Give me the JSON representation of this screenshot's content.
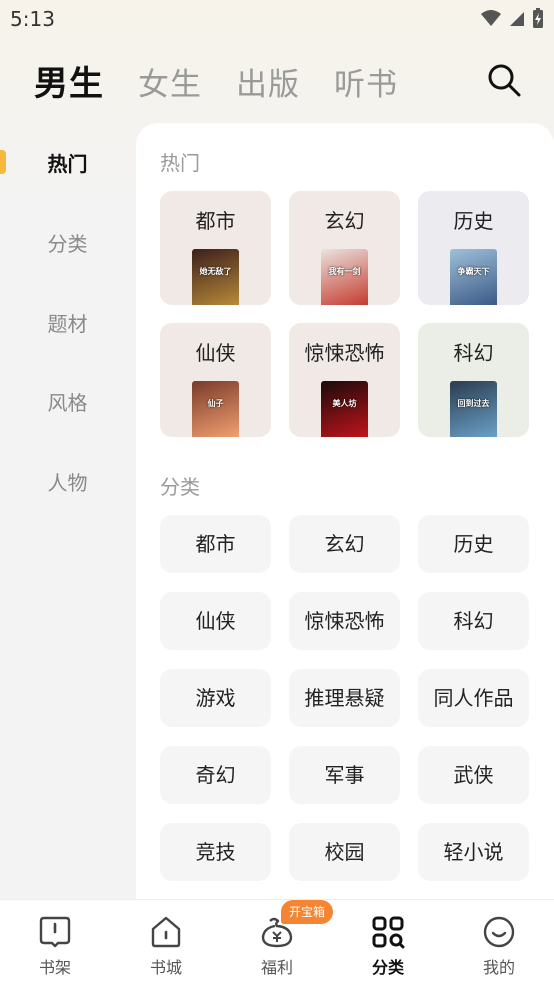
{
  "status_bar": {
    "time": "5:13"
  },
  "top_tabs": [
    {
      "label": "男生",
      "active": true
    },
    {
      "label": "女生",
      "active": false
    },
    {
      "label": "出版",
      "active": false
    },
    {
      "label": "听书",
      "active": false
    }
  ],
  "left_rail": {
    "items": [
      {
        "label": "热门",
        "active": true
      },
      {
        "label": "分类",
        "active": false
      },
      {
        "label": "题材",
        "active": false
      },
      {
        "label": "风格",
        "active": false
      },
      {
        "label": "人物",
        "active": false
      }
    ],
    "accent_color": "#f6b93b"
  },
  "hot_section": {
    "title": "热门",
    "cards": [
      {
        "label": "都市",
        "bg": "#f1e9e6",
        "cover_colors": [
          "#3a1f1a",
          "#b88a3a"
        ],
        "cover_text": "她无敌了"
      },
      {
        "label": "玄幻",
        "bg": "#f1e9e6",
        "cover_colors": [
          "#e9e3df",
          "#c53b2e"
        ],
        "cover_text": "我有一剑"
      },
      {
        "label": "历史",
        "bg": "#ebebf0",
        "cover_colors": [
          "#9fc0d9",
          "#3c5a86"
        ],
        "cover_text": "争霸天下"
      },
      {
        "label": "仙侠",
        "bg": "#f1e9e6",
        "cover_colors": [
          "#7a3a2a",
          "#f0a070"
        ],
        "cover_text": "仙子"
      },
      {
        "label": "惊悚恐怖",
        "bg": "#f1e9e6",
        "cover_colors": [
          "#1a0a0a",
          "#c0141c"
        ],
        "cover_text": "美人坊"
      },
      {
        "label": "科幻",
        "bg": "#ebeee7",
        "cover_colors": [
          "#2b3c4f",
          "#6aa0c8"
        ],
        "cover_text": "回到过去"
      }
    ]
  },
  "category_section": {
    "title": "分类",
    "items": [
      "都市",
      "玄幻",
      "历史",
      "仙侠",
      "惊悚恐怖",
      "科幻",
      "游戏",
      "推理悬疑",
      "同人作品",
      "奇幻",
      "军事",
      "武侠",
      "竞技",
      "校园",
      "轻小说"
    ]
  },
  "bottom_nav": {
    "items": [
      {
        "label": "书架",
        "icon": "bookshelf-icon",
        "active": false
      },
      {
        "label": "书城",
        "icon": "bookstore-icon",
        "active": false
      },
      {
        "label": "福利",
        "icon": "welfare-icon",
        "active": false
      },
      {
        "label": "分类",
        "icon": "category-icon",
        "active": true
      },
      {
        "label": "我的",
        "icon": "profile-icon",
        "active": false
      }
    ],
    "badge": "开宝箱",
    "badge_color": "#f58533"
  }
}
